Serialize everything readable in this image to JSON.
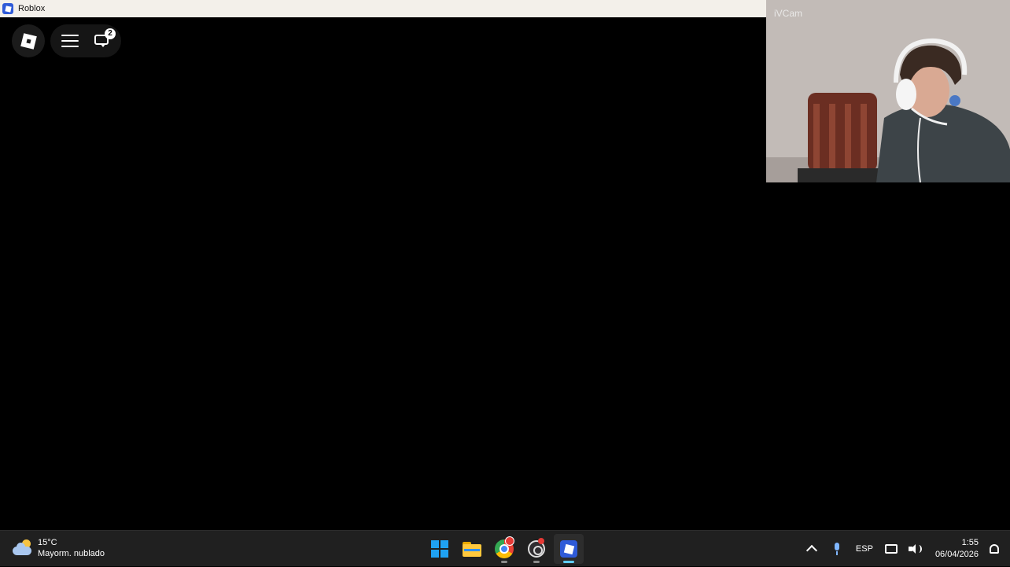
{
  "window": {
    "title": "Roblox"
  },
  "game_overlay": {
    "menu_icon": "hamburger-menu-icon",
    "chat_icon": "chat-icon",
    "chat_badge_count": "2"
  },
  "webcam": {
    "label": "iVCam"
  },
  "taskbar": {
    "weather": {
      "temperature": "15°C",
      "condition": "Mayorm. nublado"
    },
    "pinned_apps": [
      "start",
      "file-explorer",
      "chrome",
      "obs-studio",
      "roblox"
    ],
    "tray": {
      "language": "ESP",
      "time": "1:55",
      "date": "06/04/2026"
    }
  }
}
